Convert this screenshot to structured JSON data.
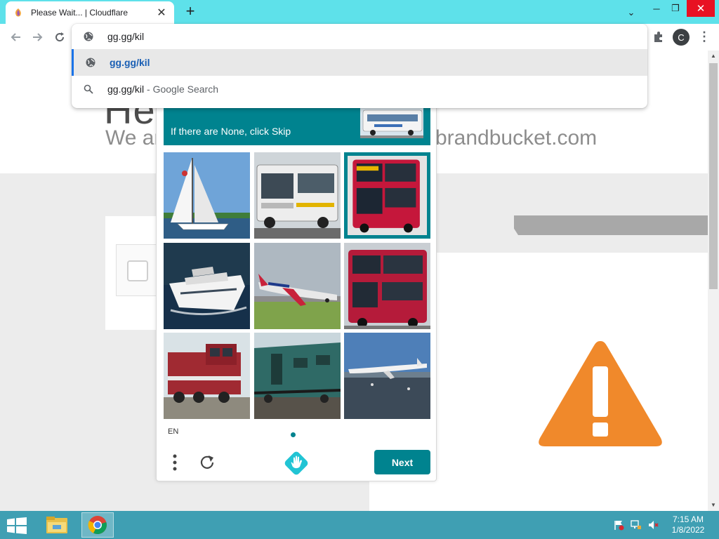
{
  "browser": {
    "tab_title": "Please Wait... | Cloudflare",
    "close_tab": "✕",
    "new_tab": "+",
    "tab_search": "⌄",
    "minimize": "─",
    "maximize": "❐",
    "close_window": "✕",
    "profile_initial": "C",
    "omnibox": {
      "text": "gg.gg/kil",
      "suggestions": [
        {
          "text": "gg.gg/kil",
          "suffix": "",
          "icon": "globe-icon"
        },
        {
          "text": "gg.gg/kil",
          "suffix": " - Google Search",
          "icon": "search-icon"
        }
      ]
    }
  },
  "page": {
    "hero_title": "He",
    "hero_subtitle": "We ar",
    "hero_domain": "brandbucket.com",
    "warning_color": "#f0892b"
  },
  "captcha": {
    "prompt_text": "If there are None, click Skip",
    "language": "EN",
    "next_label": "Next",
    "accent_color": "#00838f",
    "tiles": [
      {
        "subject": "sailboat",
        "selected": false
      },
      {
        "subject": "bus",
        "selected": false
      },
      {
        "subject": "double-decker-bus",
        "selected": true
      },
      {
        "subject": "yacht",
        "selected": false
      },
      {
        "subject": "airplane",
        "selected": false
      },
      {
        "subject": "double-decker-bus",
        "selected": false
      },
      {
        "subject": "train-locomotive",
        "selected": false
      },
      {
        "subject": "train-carriage",
        "selected": false
      },
      {
        "subject": "airplane",
        "selected": false
      }
    ]
  },
  "taskbar": {
    "time": "7:15 AM",
    "date": "1/8/2022"
  }
}
